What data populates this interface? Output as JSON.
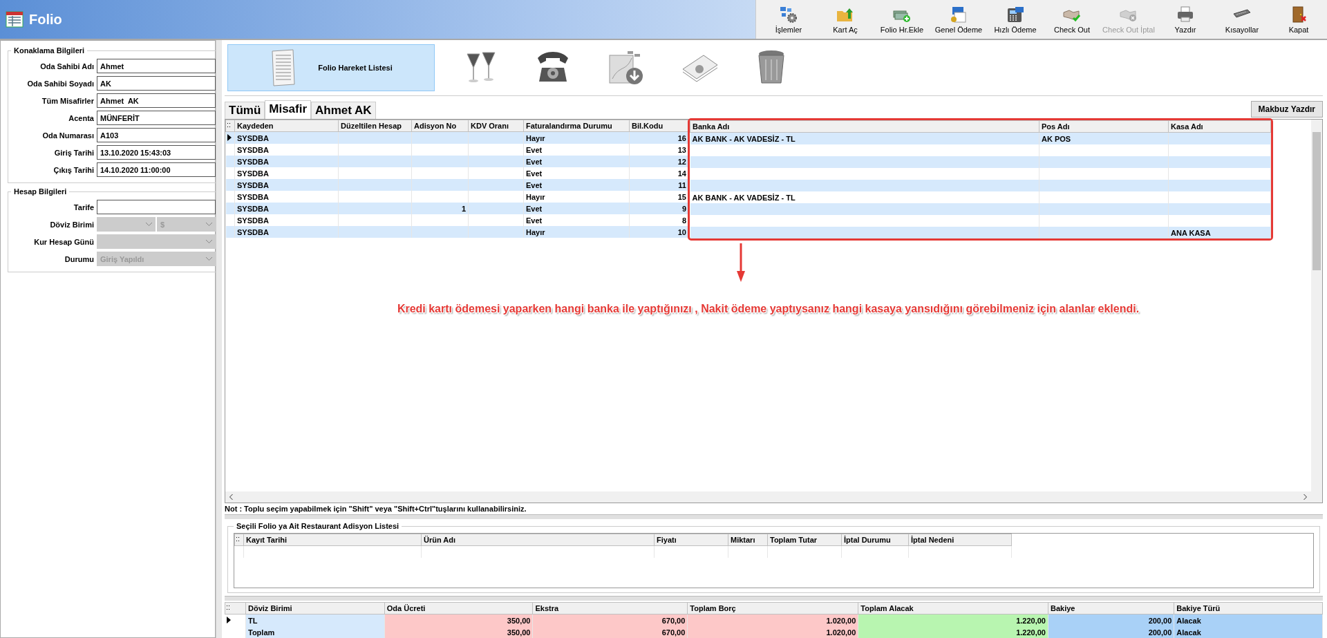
{
  "window": {
    "title": "Folio"
  },
  "toolbar": [
    {
      "kind": "gears",
      "label": "İşlemler",
      "disabled": false
    },
    {
      "kind": "folder",
      "label": "Kart Aç",
      "disabled": false
    },
    {
      "kind": "money",
      "label": "Folio Hr.Ekle",
      "disabled": false
    },
    {
      "kind": "payment",
      "label": "Genel Ödeme",
      "disabled": false
    },
    {
      "kind": "terminal",
      "label": "Hızlı Ödeme",
      "disabled": false
    },
    {
      "kind": "handshake",
      "label": "Check Out",
      "disabled": false
    },
    {
      "kind": "handshake-cancel",
      "label": "Check Out İptal",
      "disabled": true
    },
    {
      "kind": "printer",
      "label": "Yazdır",
      "disabled": false
    },
    {
      "kind": "keyboard",
      "label": "Kısayollar",
      "disabled": false
    },
    {
      "kind": "door",
      "label": "Kapat",
      "disabled": false
    }
  ],
  "stay_info": {
    "title": "Konaklama Bilgileri",
    "fields": [
      {
        "label": "Oda Sahibi Adı",
        "value": "Ahmet"
      },
      {
        "label": "Oda Sahibi Soyadı",
        "value": "AK"
      },
      {
        "label": "Tüm Misafirler",
        "value": "Ahmet  AK"
      },
      {
        "label": "Acenta",
        "value": "MÜNFERİT"
      },
      {
        "label": "Oda Numarası",
        "value": "A103"
      },
      {
        "label": "Giriş Tarihi",
        "value": "13.10.2020 15:43:03"
      },
      {
        "label": "Çıkış Tarihi",
        "value": "14.10.2020 11:00:00"
      }
    ]
  },
  "account_info": {
    "title": "Hesap Bilgileri",
    "fields": [
      {
        "kind": "text",
        "label": "Tarife",
        "disabled": false
      },
      {
        "kind": "double-select",
        "label": "Döviz Birimi",
        "value": "$",
        "disabled": true
      },
      {
        "kind": "select",
        "label": "Kur Hesap Günü",
        "disabled": true
      },
      {
        "kind": "select",
        "label": "Durumu",
        "value": "Giriş Yapıldı",
        "disabled": true
      }
    ]
  },
  "view_buttons": [
    {
      "kind": "list",
      "label": "Folio Hareket Listesi",
      "selected": true
    },
    {
      "kind": "glasses",
      "selected": false
    },
    {
      "kind": "phone",
      "selected": false
    },
    {
      "kind": "download",
      "selected": false
    },
    {
      "kind": "papers",
      "selected": false
    },
    {
      "kind": "trash",
      "selected": false
    }
  ],
  "tabs": [
    {
      "label": "Tümü",
      "selected": false
    },
    {
      "label": "Misafir",
      "selected": true
    },
    {
      "label": "Ahmet  AK",
      "selected": false
    }
  ],
  "print_button": "Makbuz Yazdır",
  "grid": {
    "columns": [
      {
        "label": "Kaydeden",
        "numeric": false,
        "highlighted": false
      },
      {
        "label": "Düzeltilen Hesap",
        "numeric": false,
        "highlighted": false
      },
      {
        "label": "Adisyon No",
        "numeric": true,
        "highlighted": false
      },
      {
        "label": "KDV Oranı",
        "numeric": false,
        "highlighted": false
      },
      {
        "label": "Faturalandırma Durumu",
        "numeric": false,
        "highlighted": false
      },
      {
        "label": "Bil.Kodu",
        "numeric": true,
        "highlighted": false
      },
      {
        "label": "Banka Adı",
        "numeric": false,
        "highlighted": true
      },
      {
        "label": "Pos Adı",
        "numeric": false,
        "highlighted": true
      },
      {
        "label": "Kasa Adı",
        "numeric": false,
        "highlighted": true
      }
    ],
    "rows": [
      {
        "current": true,
        "cells": [
          "SYSDBA",
          null,
          null,
          null,
          "Hayır",
          "16",
          "AK BANK  - AK VADESİZ - TL",
          "AK POS",
          null
        ]
      },
      {
        "current": false,
        "cells": [
          "SYSDBA",
          null,
          null,
          null,
          "Evet",
          "13",
          null,
          null,
          null
        ]
      },
      {
        "current": false,
        "cells": [
          "SYSDBA",
          null,
          null,
          null,
          "Evet",
          "12",
          null,
          null,
          null
        ]
      },
      {
        "current": false,
        "cells": [
          "SYSDBA",
          null,
          null,
          null,
          "Evet",
          "14",
          null,
          null,
          null
        ]
      },
      {
        "current": false,
        "cells": [
          "SYSDBA",
          null,
          null,
          null,
          "Evet",
          "11",
          null,
          null,
          null
        ]
      },
      {
        "current": false,
        "cells": [
          "SYSDBA",
          null,
          null,
          null,
          "Hayır",
          "15",
          "AK BANK  - AK VADESİZ - TL",
          null,
          null
        ]
      },
      {
        "current": false,
        "cells": [
          "SYSDBA",
          null,
          "1",
          null,
          "Evet",
          "9",
          null,
          null,
          null
        ]
      },
      {
        "current": false,
        "cells": [
          "SYSDBA",
          null,
          null,
          null,
          "Evet",
          "8",
          null,
          null,
          null
        ]
      },
      {
        "current": false,
        "cells": [
          "SYSDBA",
          null,
          null,
          null,
          "Hayır",
          "10",
          null,
          null,
          "ANA KASA"
        ]
      }
    ]
  },
  "annotation": "Kredi kartı ödemesi yaparken hangi banka ile yaptığınızı , Nakit ödeme yaptıysanız hangi kasaya yansıdığını görebilmeniz için alanlar eklendi.",
  "note": "Not : Toplu seçim yapabilmek için \"Shift\" veya \"Shift+Ctrl\"tuşlarını kullanabilirsiniz.",
  "restaurant": {
    "title": "Seçili Folio ya Ait Restaurant Adisyon Listesi",
    "columns": [
      "Kayıt Tarihi",
      "Ürün Adı",
      "Fiyatı",
      "Miktarı",
      "Toplam Tutar",
      "İptal Durumu",
      "İptal Nedeni"
    ]
  },
  "totals": {
    "columns": [
      {
        "label": "Döviz Birimi",
        "color": "#d6e9fc"
      },
      {
        "label": "Oda Ücreti",
        "color": "#fdc8c8"
      },
      {
        "label": "Ekstra",
        "color": "#fdc8c8"
      },
      {
        "label": "Toplam Borç",
        "color": "#fdc8c8"
      },
      {
        "label": "Toplam Alacak",
        "color": "#b8f5b0"
      },
      {
        "label": "Bakiye",
        "color": "#a9d1f7"
      },
      {
        "label": "Bakiye Türü",
        "color": "#a9d1f7"
      }
    ],
    "rows": [
      {
        "current": true,
        "cells": [
          "TL",
          "350,00",
          "670,00",
          "1.020,00",
          "1.220,00",
          "200,00",
          "Alacak"
        ]
      },
      {
        "current": false,
        "cells": [
          "Toplam",
          "350,00",
          "670,00",
          "1.020,00",
          "1.220,00",
          "200,00",
          "Alacak"
        ]
      }
    ]
  }
}
